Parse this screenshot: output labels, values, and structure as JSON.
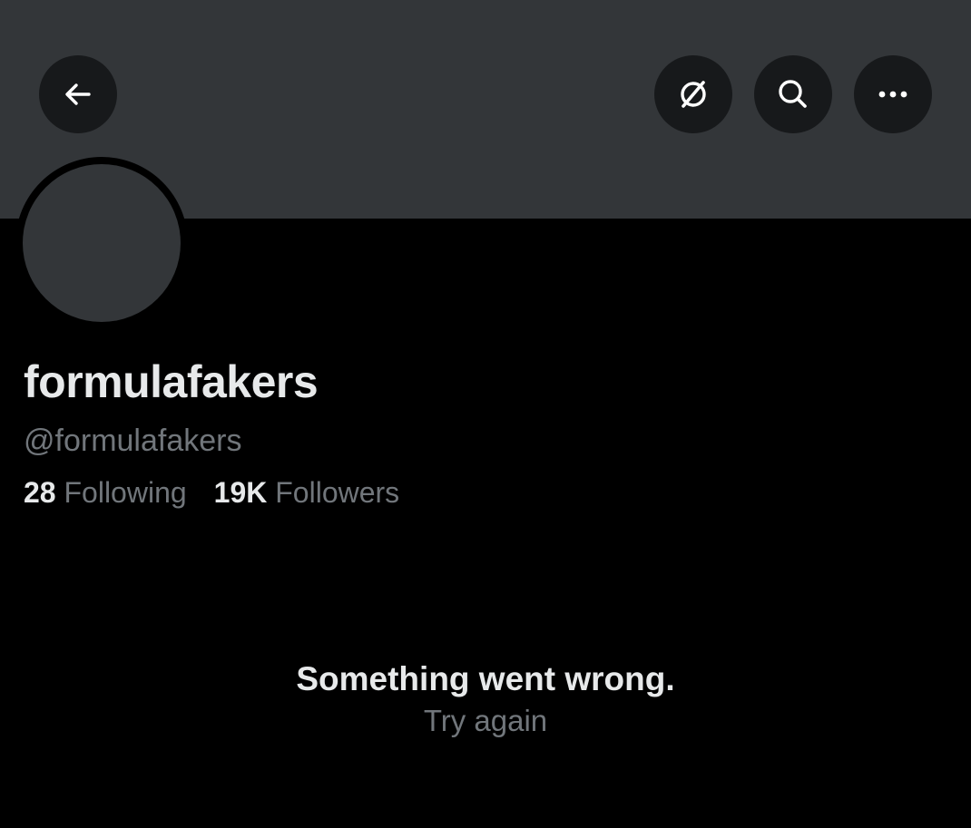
{
  "profile": {
    "display_name": "formulafakers",
    "handle": "@formulafakers",
    "following_count": "28",
    "following_label": "Following",
    "followers_count": "19K",
    "followers_label": "Followers"
  },
  "toolbar": {
    "back_icon": "arrow-left-icon",
    "grok_icon": "grok-icon",
    "search_icon": "search-icon",
    "more_icon": "more-horizontal-icon"
  },
  "error": {
    "message": "Something went wrong.",
    "retry_label": "Try again"
  },
  "colors": {
    "background": "#000000",
    "banner": "#333639",
    "primary_text": "#e7e9ea",
    "secondary_text": "#71767b"
  }
}
